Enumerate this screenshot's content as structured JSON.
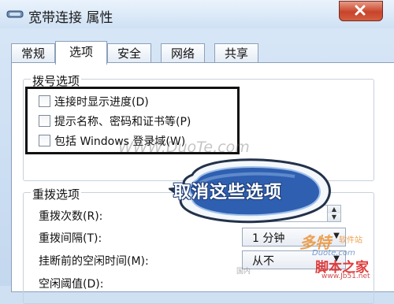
{
  "window": {
    "title": "宽带连接 属性",
    "close_icon": "close-icon",
    "app_icon": "network-connection-icon"
  },
  "tabs": [
    {
      "label": "常规",
      "active": false
    },
    {
      "label": "选项",
      "active": true
    },
    {
      "label": "安全",
      "active": false
    },
    {
      "label": "网络",
      "active": false
    },
    {
      "label": "共享",
      "active": false
    }
  ],
  "dial_options": {
    "title": "拨号选项",
    "items": [
      {
        "label": "连接时显示进度(D)",
        "checked": false
      },
      {
        "label": "提示名称、密码和证书等(P)",
        "checked": false
      },
      {
        "label": "包括 Windows 登录域(W)",
        "checked": false
      }
    ]
  },
  "redial_options": {
    "title": "重拨选项",
    "redial_count_label": "重拨次数(R):",
    "redial_interval_label": "重拨间隔(T):",
    "redial_interval_value": "1 分钟",
    "idle_hangup_label": "挂断前的空闲时间(M):",
    "idle_hangup_value": "从不",
    "partial_label": "空闲阈值(D):"
  },
  "annotation": {
    "callout_text": "取消这些选项"
  },
  "watermarks": {
    "duote_center": "WWW.DuoTe.com",
    "duote_logo": "多特",
    "duote_logo_sub": "软件站",
    "duote_small": "Duote.com",
    "jb51_logo": "脚本之家",
    "jb51_url": "www.Jb51.net",
    "guonei": "国内"
  },
  "colors": {
    "highlight_border": "#111111",
    "callout_fill": "#2f5fb0",
    "close_button": "#c8442b"
  }
}
